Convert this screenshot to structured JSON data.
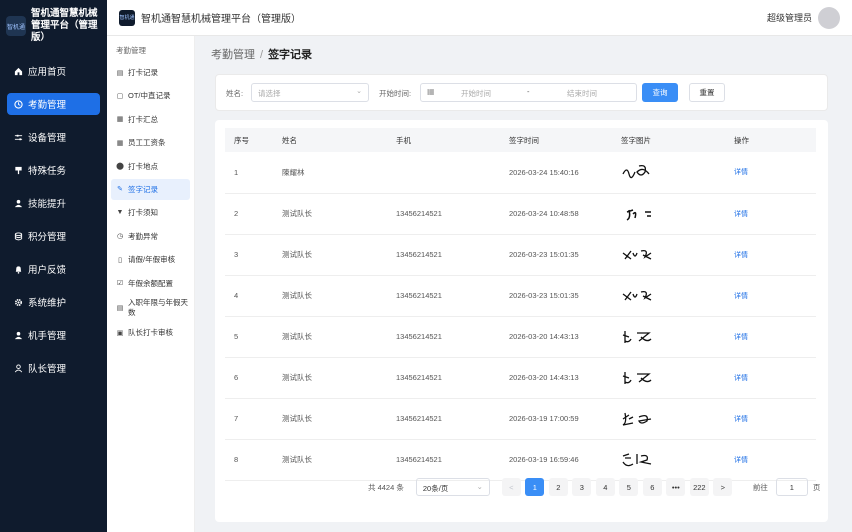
{
  "brand": {
    "title_line1": "智机通智慧机械",
    "title_line2": "管理平台（管理版）",
    "logo_text": "智机通"
  },
  "topbar": {
    "title": "智机通智慧机械管理平台（管理版）",
    "user": "超级管理员",
    "logo_text": "智机通"
  },
  "sidebar": {
    "items": [
      {
        "label": "应用首页",
        "icon": "home-icon"
      },
      {
        "label": "考勤管理",
        "icon": "clock-icon",
        "active": true
      },
      {
        "label": "设备管理",
        "icon": "sliders-icon"
      },
      {
        "label": "特殊任务",
        "icon": "flag-icon"
      },
      {
        "label": "技能提升",
        "icon": "user-icon"
      },
      {
        "label": "积分管理",
        "icon": "database-icon"
      },
      {
        "label": "用户反馈",
        "icon": "bell-icon"
      },
      {
        "label": "系统维护",
        "icon": "gear-icon"
      },
      {
        "label": "机手管理",
        "icon": "user-icon"
      },
      {
        "label": "队长管理",
        "icon": "user-outline-icon"
      }
    ]
  },
  "submenu": {
    "header": "考勤管理",
    "items": [
      {
        "label": "打卡记录"
      },
      {
        "label": "OT/中直记录"
      },
      {
        "label": "打卡汇总"
      },
      {
        "label": "员工工资条"
      },
      {
        "label": "打卡地点"
      },
      {
        "label": "签字记录",
        "active": true
      },
      {
        "label": "打卡须知"
      },
      {
        "label": "考勤异常"
      },
      {
        "label": "请假/年假审核"
      },
      {
        "label": "年假余额配置"
      },
      {
        "label": "入职年限与年假天数"
      },
      {
        "label": "队长打卡审核"
      }
    ]
  },
  "breadcrumb": {
    "parent": "考勤管理",
    "separator": "/",
    "current": "签字记录"
  },
  "filter": {
    "name_label": "姓名:",
    "name_placeholder": "请选择",
    "time_label": "开始时间:",
    "start_placeholder": "开始时间",
    "range_separator": "-",
    "end_placeholder": "结束时间",
    "search_button": "查询",
    "reset_button": "重置"
  },
  "table": {
    "headers": [
      "序号",
      "姓名",
      "手机",
      "签字时间",
      "签字图片",
      "操作"
    ],
    "rows": [
      {
        "no": "1",
        "name": "陳耀林",
        "phone": "",
        "time": "2026-03-24 15:40:16",
        "action": "详情"
      },
      {
        "no": "2",
        "name": "测试队长",
        "phone": "13456214521",
        "time": "2026-03-24 10:48:58",
        "action": "详情"
      },
      {
        "no": "3",
        "name": "测试队长",
        "phone": "13456214521",
        "time": "2026-03-23 15:01:35",
        "action": "详情"
      },
      {
        "no": "4",
        "name": "测试队长",
        "phone": "13456214521",
        "time": "2026-03-23 15:01:35",
        "action": "详情"
      },
      {
        "no": "5",
        "name": "测试队长",
        "phone": "13456214521",
        "time": "2026-03-20 14:43:13",
        "action": "详情"
      },
      {
        "no": "6",
        "name": "测试队长",
        "phone": "13456214521",
        "time": "2026-03-20 14:43:13",
        "action": "详情"
      },
      {
        "no": "7",
        "name": "测试队长",
        "phone": "13456214521",
        "time": "2026-03-19 17:00:59",
        "action": "详情"
      },
      {
        "no": "8",
        "name": "测试队长",
        "phone": "13456214521",
        "time": "2026-03-19 16:59:46",
        "action": "详情"
      }
    ]
  },
  "pagination": {
    "total": "共 4424 条",
    "page_size": "20条/页",
    "pages": [
      "1",
      "2",
      "3",
      "4",
      "5",
      "6",
      "•••",
      "222"
    ],
    "current_page": "1",
    "prev": "<",
    "next": ">",
    "goto_label": "前往",
    "goto_value": "1",
    "goto_suffix": "页"
  },
  "colors": {
    "sidebar_bg": "#0f1b2d",
    "accent": "#1e6fe6",
    "primary_button": "#3a8ef6"
  }
}
